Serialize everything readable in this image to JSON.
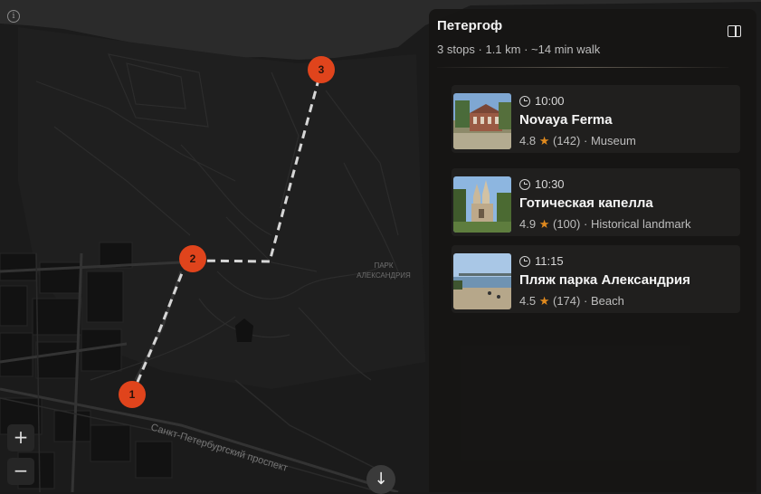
{
  "map": {
    "park_label_line1": "ПАРК",
    "park_label_line2": "АЛЕКСАНДРИЯ",
    "street_label": "Санкт-Петербургский проспект",
    "markers": [
      {
        "number": "1"
      },
      {
        "number": "2"
      },
      {
        "number": "3"
      }
    ],
    "marker_color": "#e0441c",
    "route_color": "#d6d6d6"
  },
  "controls": {
    "info_glyph": "i",
    "zoom_in": "+",
    "zoom_out": "−",
    "scroll_down": "↓",
    "info_icon": "info-icon",
    "scroll_icon": "arrow-down-icon",
    "panel_toggle_icon": "sidebar-toggle-icon"
  },
  "panel": {
    "title": "Петергоф",
    "summary": "3 stops · 1.1 km · ~14 min walk",
    "stops": [
      {
        "time": "10:00",
        "name": "Novaya Ferma",
        "rating": "4.8",
        "reviews": "(142)",
        "category": "Museum"
      },
      {
        "time": "10:30",
        "name": "Готическая капелла",
        "rating": "4.9",
        "reviews": "(100)",
        "category": "Historical landmark"
      },
      {
        "time": "11:15",
        "name": "Пляж парка Александрия",
        "rating": "4.5",
        "reviews": "(174)",
        "category": "Beach"
      }
    ],
    "star_glyph": "★",
    "separator": "·"
  }
}
